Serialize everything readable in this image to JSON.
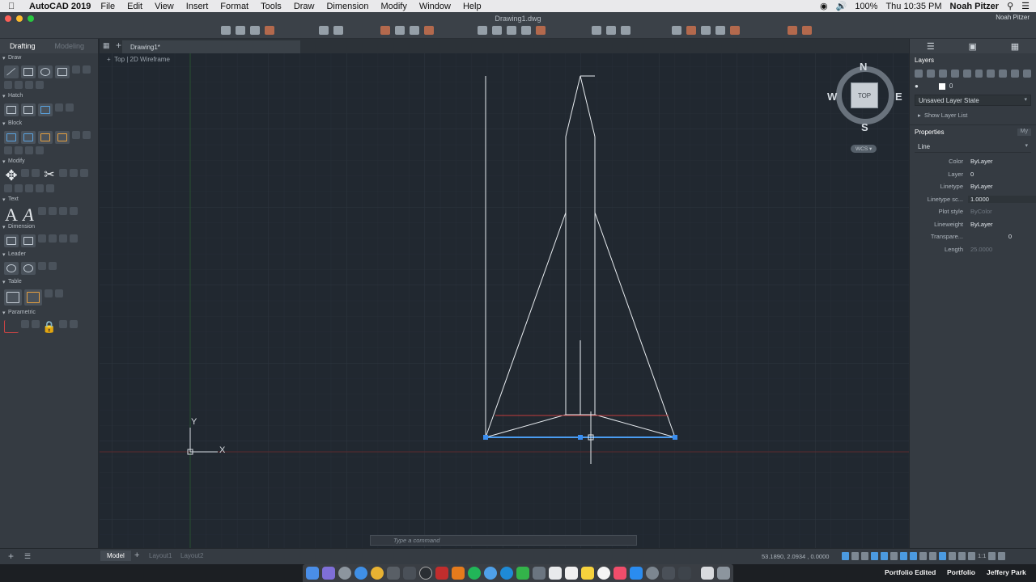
{
  "menubar": {
    "app_name": "AutoCAD 2019",
    "menus": [
      "File",
      "Edit",
      "View",
      "Insert",
      "Format",
      "Tools",
      "Draw",
      "Dimension",
      "Modify",
      "Window",
      "Help"
    ],
    "battery": "100%",
    "clock": "Thu 10:35 PM",
    "user": "Noah Pitzer"
  },
  "window": {
    "title": "Drawing1.dwg",
    "user_badge": "Noah Pitzer"
  },
  "left_panel": {
    "tabs": [
      "Drafting",
      "Modeling"
    ],
    "sections": [
      "Draw",
      "Hatch",
      "Block",
      "Modify",
      "Text",
      "Dimension",
      "Leader",
      "Table",
      "Parametric"
    ]
  },
  "document": {
    "tab_label": "Drawing1*",
    "viewport_label": "Top | 2D Wireframe"
  },
  "viewcube": {
    "north": "N",
    "south": "S",
    "east": "E",
    "west": "W",
    "face": "TOP",
    "ucs": "WCS"
  },
  "ucs": {
    "x_label": "X",
    "y_label": "Y"
  },
  "layers": {
    "header": "Layers",
    "current_layer": "0",
    "layer_state": "Unsaved Layer State",
    "show_list": "Show Layer List"
  },
  "properties": {
    "header": "Properties",
    "my_tab": "My",
    "object_type": "Line",
    "rows": [
      {
        "label": "Color",
        "value": "ByLayer"
      },
      {
        "label": "Layer",
        "value": "0"
      },
      {
        "label": "Linetype",
        "value": "ByLayer"
      },
      {
        "label": "Linetype sc...",
        "value": "1.0000"
      },
      {
        "label": "Plot style",
        "value": "ByColor"
      },
      {
        "label": "Lineweight",
        "value": "ByLayer"
      },
      {
        "label": "Transpare...",
        "value": "0"
      },
      {
        "label": "Length",
        "value": "25.0000"
      }
    ]
  },
  "command_line": {
    "placeholder": "Type a command"
  },
  "status": {
    "tabs": [
      "Model",
      "Layout1",
      "Layout2"
    ],
    "coordinates": "53.1890, 2.0934 , 0.0000",
    "scale": "1:1"
  },
  "dock": {
    "portfolio_edited": "Portfolio Edited",
    "portfolio": "Portfolio",
    "user": "Jeffery Park"
  }
}
